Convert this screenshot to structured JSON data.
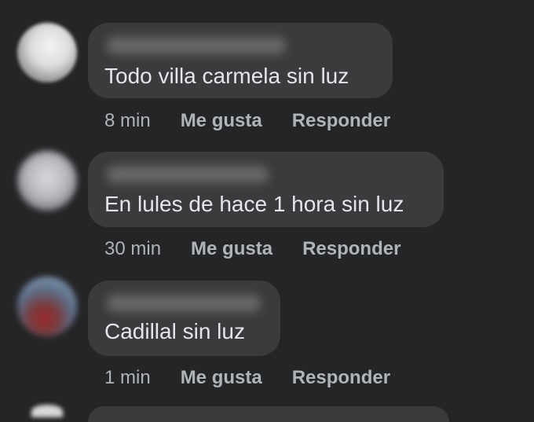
{
  "comments": [
    {
      "author_name": "",
      "text": "Todo villa carmela sin luz",
      "time": "8 min",
      "like_label": "Me gusta",
      "reply_label": "Responder"
    },
    {
      "author_name": "",
      "text": "En lules de hace 1 hora sin luz",
      "time": "30 min",
      "like_label": "Me gusta",
      "reply_label": "Responder"
    },
    {
      "author_name": "",
      "text": "Cadillal sin luz",
      "time": "1 min",
      "like_label": "Me gusta",
      "reply_label": "Responder"
    }
  ],
  "colors": {
    "background": "#242526",
    "bubble": "#3a3b3c",
    "primary_text": "#e4e6eb",
    "secondary_text": "#b0b3b8"
  }
}
